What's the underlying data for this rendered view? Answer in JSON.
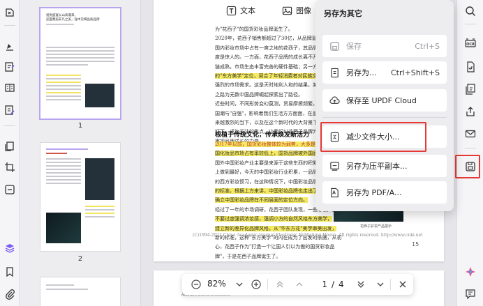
{
  "toolbar": {
    "text_label": "文本",
    "image_label": "图像"
  },
  "thumbnails": {
    "pages": [
      {
        "number": "1",
        "selected": true
      },
      {
        "number": "2",
        "selected": false
      }
    ],
    "page1_title_lines": [
      "视觉盛宴从山高潮来，",
      "迎面邂逅非凡之美，强中见细品质品牌"
    ]
  },
  "document": {
    "lines_top": [
      "为\"花西子\"的国货彩妆品牌诞生了。",
      "2020年，花西子销售额超过了30亿，从品牌诞生到今天在",
      "国内彩妆市场中占有一席之地的花西子，其品牌的扩张速",
      "度是惊人的。一方面，花西子品牌的成长离不开国内彩妆产业",
      "链成熟，市场生态丰富完善的硬件基础；另一方面，花西子品牌",
      "的\"东方美学\"定位，契合了年轻消费者对民族文化认同感越来越",
      "强烈的市场需求。这是天时地利人和的结果，某种程度上，花西子品牌",
      "之路为无数中国品牌崛起探索出了路径。",
      "近些时间，不同形势变幻莫测，贸易摩擦频繁，国防和",
      "国潮与\"自强\"，影响着我们生活方方面面，在品牌竞争力越",
      "来越激烈的当下，以及在这个新时代的大背景下，\"中国品牌\"再次走到聚光",
      "灯下，成为关注的焦点，让我们以花西子品牌为代表，重新去",
      "审视品牌成长的力量。"
    ],
    "section_heading": "根植于传统文化，传承焕发新活力",
    "lines_bottom": [
      "2017年以前，国货彩妆整体较为弱势，大多是在中国国",
      "国化妆品市场占有率较低上，国货品牌被外国品牌碾压，这是",
      "国外中国彩妆产业主要是来源于这些东西的积累，同时中国彩",
      "上做到最好，今天的中国彩妆行业积累，一品牌越来越发展",
      "的西方彩妆惯习，在这种情况下，中国彩妆品牌开始探索新",
      "的标准，根据上方来讲，中国彩妆品牌也走出了东方之路，",
      "确立中国彩妆品牌在不同层面的定位方向。",
      "经过了一年的市场调研，花西子团队发现，一些彩妆产品",
      "不要过度强调浓妆感，强调小方的自然风格东方美学，",
      "建立新的差异化品牌风格，从\"华东方花\"美学审美出发，",
      "新的标准，这种\"东方美学\"的内在成为了出发的依据，从初",
      "心，花西子作为\"打造一个让国人引以为傲的国货彩妆品",
      "牌\"，于是花西子品牌诞生了。"
    ],
    "img_caption": "图片来源：花西子官方旗舰店",
    "img2_caption": "花西子彩妆产品展示",
    "footer": "(C)1994-2021 China Academic Journal Electronic Publishing House. All rights reserved.    http://www.cnki.net",
    "page_number": "15",
    "brand_footer": "品牌视角 Brand Directions"
  },
  "zoom_bar": {
    "zoom_value": "82%",
    "current_page": "1",
    "separator": "/",
    "total_pages": "4"
  },
  "save_popup": {
    "title": "另存为其它",
    "items": [
      {
        "label": "保存",
        "shortcut": "Ctrl+S",
        "disabled": true
      },
      {
        "label": "另存为...",
        "shortcut": "Ctrl+Shift+S",
        "disabled": false
      },
      {
        "label": "保存至 UPDF Cloud",
        "shortcut": "",
        "disabled": false
      },
      {
        "label": "减少文件大小...",
        "shortcut": "",
        "disabled": false
      },
      {
        "label": "另存为压平副本...",
        "shortcut": "",
        "disabled": false
      },
      {
        "label": "另存为 PDF/A...",
        "shortcut": "",
        "disabled": false
      }
    ]
  },
  "right_rail": {
    "ocr_label": "OCR"
  },
  "colors": {
    "accent_purple": "#7b5cf0",
    "highlight_red": "#e53935",
    "highlight_yellow": "#f5ea60"
  }
}
